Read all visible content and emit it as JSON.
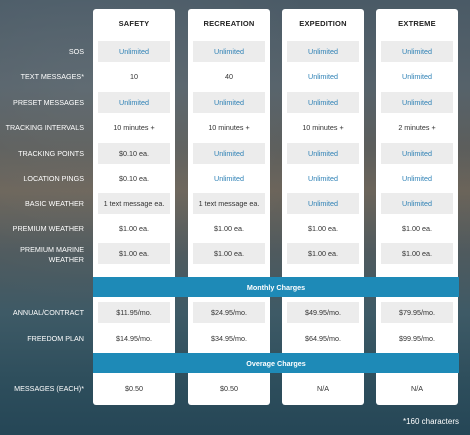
{
  "plans": [
    {
      "name": "SAFETY",
      "values": [
        "Unlimited",
        "10",
        "Unlimited",
        "10 minutes +",
        "$0.10 ea.",
        "$0.10 ea.",
        "1 text message ea.",
        "$1.00 ea.",
        "$1.00 ea.",
        "$11.95/mo.",
        "$14.95/mo.",
        "$0.50"
      ]
    },
    {
      "name": "RECREATION",
      "values": [
        "Unlimited",
        "40",
        "Unlimited",
        "10 minutes +",
        "Unlimited",
        "Unlimited",
        "1 text message ea.",
        "$1.00 ea.",
        "$1.00 ea.",
        "$24.95/mo.",
        "$34.95/mo.",
        "$0.50"
      ]
    },
    {
      "name": "EXPEDITION",
      "values": [
        "Unlimited",
        "Unlimited",
        "Unlimited",
        "10 minutes +",
        "Unlimited",
        "Unlimited",
        "Unlimited",
        "$1.00 ea.",
        "$1.00 ea.",
        "$49.95/mo.",
        "$64.95/mo.",
        "N/A"
      ]
    },
    {
      "name": "EXTREME",
      "values": [
        "Unlimited",
        "Unlimited",
        "Unlimited",
        "2 minutes +",
        "Unlimited",
        "Unlimited",
        "Unlimited",
        "$1.00 ea.",
        "$1.00 ea.",
        "$79.95/mo.",
        "$99.95/mo.",
        "N/A"
      ]
    }
  ],
  "rows": [
    "SOS",
    "TEXT MESSAGES*",
    "PRESET MESSAGES",
    "TRACKING INTERVALS",
    "TRACKING POINTS",
    "LOCATION PINGS",
    "BASIC WEATHER",
    "PREMIUM WEATHER",
    "PREMIUM MARINE WEATHER",
    "ANNUAL/CONTRACT",
    "FREEDOM PLAN",
    "MESSAGES (EACH)*"
  ],
  "sections": {
    "monthly": "Monthly Charges",
    "overage": "Overage Charges"
  },
  "footnote": "*160 characters",
  "colors": {
    "band": "#1e8ab7",
    "link": "#2d80b5"
  }
}
